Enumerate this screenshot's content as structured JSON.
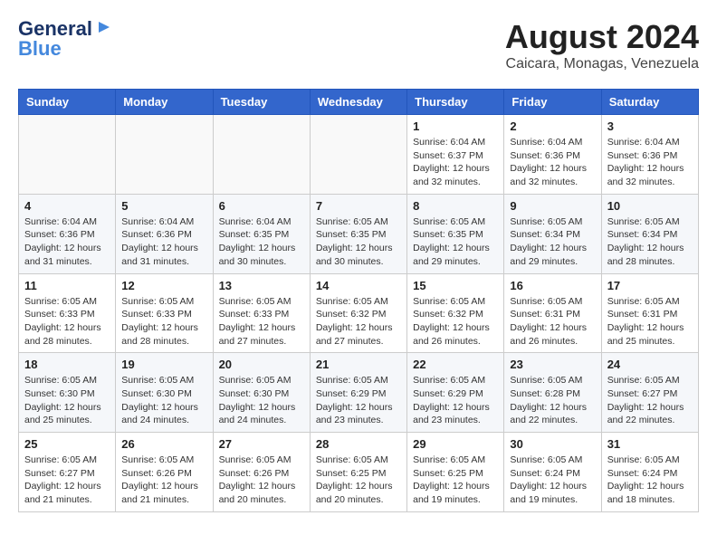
{
  "header": {
    "logo_general": "General",
    "logo_blue": "Blue",
    "title": "August 2024",
    "subtitle": "Caicara, Monagas, Venezuela"
  },
  "calendar": {
    "days": [
      "Sunday",
      "Monday",
      "Tuesday",
      "Wednesday",
      "Thursday",
      "Friday",
      "Saturday"
    ],
    "weeks": [
      {
        "cells": [
          {
            "date": "",
            "info": ""
          },
          {
            "date": "",
            "info": ""
          },
          {
            "date": "",
            "info": ""
          },
          {
            "date": "",
            "info": ""
          },
          {
            "date": "1",
            "info": "Sunrise: 6:04 AM\nSunset: 6:37 PM\nDaylight: 12 hours\nand 32 minutes."
          },
          {
            "date": "2",
            "info": "Sunrise: 6:04 AM\nSunset: 6:36 PM\nDaylight: 12 hours\nand 32 minutes."
          },
          {
            "date": "3",
            "info": "Sunrise: 6:04 AM\nSunset: 6:36 PM\nDaylight: 12 hours\nand 32 minutes."
          }
        ]
      },
      {
        "cells": [
          {
            "date": "4",
            "info": "Sunrise: 6:04 AM\nSunset: 6:36 PM\nDaylight: 12 hours\nand 31 minutes."
          },
          {
            "date": "5",
            "info": "Sunrise: 6:04 AM\nSunset: 6:36 PM\nDaylight: 12 hours\nand 31 minutes."
          },
          {
            "date": "6",
            "info": "Sunrise: 6:04 AM\nSunset: 6:35 PM\nDaylight: 12 hours\nand 30 minutes."
          },
          {
            "date": "7",
            "info": "Sunrise: 6:05 AM\nSunset: 6:35 PM\nDaylight: 12 hours\nand 30 minutes."
          },
          {
            "date": "8",
            "info": "Sunrise: 6:05 AM\nSunset: 6:35 PM\nDaylight: 12 hours\nand 29 minutes."
          },
          {
            "date": "9",
            "info": "Sunrise: 6:05 AM\nSunset: 6:34 PM\nDaylight: 12 hours\nand 29 minutes."
          },
          {
            "date": "10",
            "info": "Sunrise: 6:05 AM\nSunset: 6:34 PM\nDaylight: 12 hours\nand 28 minutes."
          }
        ]
      },
      {
        "cells": [
          {
            "date": "11",
            "info": "Sunrise: 6:05 AM\nSunset: 6:33 PM\nDaylight: 12 hours\nand 28 minutes."
          },
          {
            "date": "12",
            "info": "Sunrise: 6:05 AM\nSunset: 6:33 PM\nDaylight: 12 hours\nand 28 minutes."
          },
          {
            "date": "13",
            "info": "Sunrise: 6:05 AM\nSunset: 6:33 PM\nDaylight: 12 hours\nand 27 minutes."
          },
          {
            "date": "14",
            "info": "Sunrise: 6:05 AM\nSunset: 6:32 PM\nDaylight: 12 hours\nand 27 minutes."
          },
          {
            "date": "15",
            "info": "Sunrise: 6:05 AM\nSunset: 6:32 PM\nDaylight: 12 hours\nand 26 minutes."
          },
          {
            "date": "16",
            "info": "Sunrise: 6:05 AM\nSunset: 6:31 PM\nDaylight: 12 hours\nand 26 minutes."
          },
          {
            "date": "17",
            "info": "Sunrise: 6:05 AM\nSunset: 6:31 PM\nDaylight: 12 hours\nand 25 minutes."
          }
        ]
      },
      {
        "cells": [
          {
            "date": "18",
            "info": "Sunrise: 6:05 AM\nSunset: 6:30 PM\nDaylight: 12 hours\nand 25 minutes."
          },
          {
            "date": "19",
            "info": "Sunrise: 6:05 AM\nSunset: 6:30 PM\nDaylight: 12 hours\nand 24 minutes."
          },
          {
            "date": "20",
            "info": "Sunrise: 6:05 AM\nSunset: 6:30 PM\nDaylight: 12 hours\nand 24 minutes."
          },
          {
            "date": "21",
            "info": "Sunrise: 6:05 AM\nSunset: 6:29 PM\nDaylight: 12 hours\nand 23 minutes."
          },
          {
            "date": "22",
            "info": "Sunrise: 6:05 AM\nSunset: 6:29 PM\nDaylight: 12 hours\nand 23 minutes."
          },
          {
            "date": "23",
            "info": "Sunrise: 6:05 AM\nSunset: 6:28 PM\nDaylight: 12 hours\nand 22 minutes."
          },
          {
            "date": "24",
            "info": "Sunrise: 6:05 AM\nSunset: 6:27 PM\nDaylight: 12 hours\nand 22 minutes."
          }
        ]
      },
      {
        "cells": [
          {
            "date": "25",
            "info": "Sunrise: 6:05 AM\nSunset: 6:27 PM\nDaylight: 12 hours\nand 21 minutes."
          },
          {
            "date": "26",
            "info": "Sunrise: 6:05 AM\nSunset: 6:26 PM\nDaylight: 12 hours\nand 21 minutes."
          },
          {
            "date": "27",
            "info": "Sunrise: 6:05 AM\nSunset: 6:26 PM\nDaylight: 12 hours\nand 20 minutes."
          },
          {
            "date": "28",
            "info": "Sunrise: 6:05 AM\nSunset: 6:25 PM\nDaylight: 12 hours\nand 20 minutes."
          },
          {
            "date": "29",
            "info": "Sunrise: 6:05 AM\nSunset: 6:25 PM\nDaylight: 12 hours\nand 19 minutes."
          },
          {
            "date": "30",
            "info": "Sunrise: 6:05 AM\nSunset: 6:24 PM\nDaylight: 12 hours\nand 19 minutes."
          },
          {
            "date": "31",
            "info": "Sunrise: 6:05 AM\nSunset: 6:24 PM\nDaylight: 12 hours\nand 18 minutes."
          }
        ]
      }
    ]
  }
}
